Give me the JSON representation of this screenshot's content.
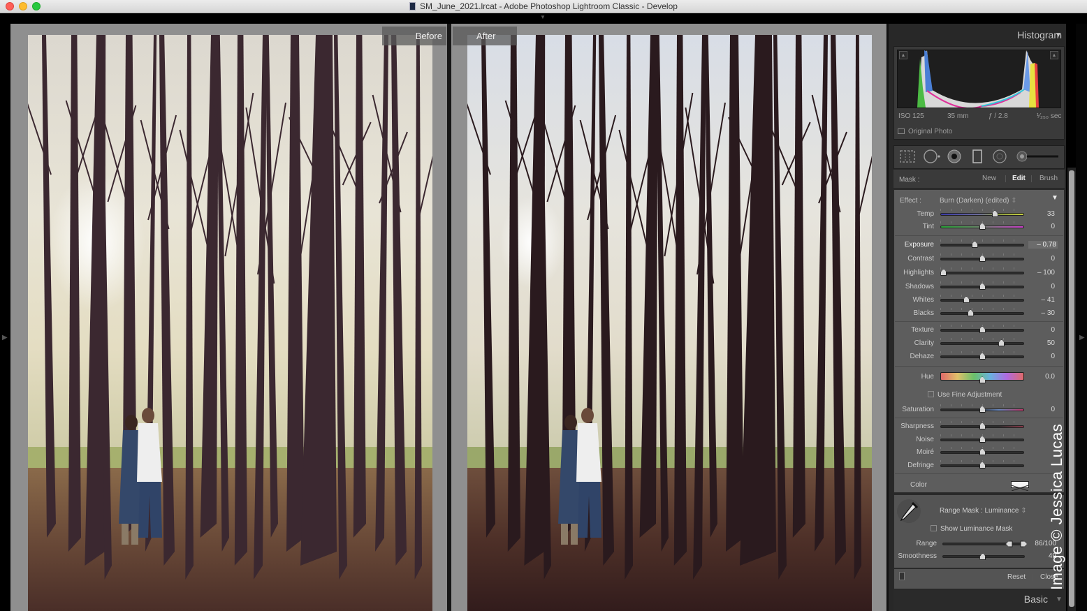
{
  "window": {
    "title": "SM_June_2021.lrcat - Adobe Photoshop Lightroom Classic - Develop"
  },
  "compare": {
    "before_label": "Before",
    "after_label": "After"
  },
  "histogram": {
    "header": "Histogram",
    "exif": {
      "iso": "ISO 125",
      "focal_length": "35 mm",
      "aperture": "ƒ / 2.8",
      "shutter": "¹⁄₂₅₀ sec"
    },
    "original_photo_label": "Original Photo",
    "original_photo_checked": false
  },
  "tool_strip": {
    "tools": [
      "crop-overlay",
      "spot-removal",
      "red-eye",
      "graduated-filter",
      "radial-filter",
      "adjustment-brush"
    ]
  },
  "mask": {
    "label": "Mask :",
    "options": [
      "New",
      "Edit",
      "Brush"
    ],
    "active": "Edit"
  },
  "effect": {
    "label": "Effect :",
    "preset": "Burn (Darken) (edited)",
    "sliders": [
      {
        "id": "temp",
        "label": "Temp",
        "value": "33",
        "pos": 0.65,
        "track": "temp"
      },
      {
        "id": "tint",
        "label": "Tint",
        "value": "0",
        "pos": 0.5,
        "track": "tint"
      },
      {
        "id": "exposure",
        "label": "Exposure",
        "value": "– 0.78",
        "pos": 0.41,
        "track": "plain",
        "highlight": true
      },
      {
        "id": "contrast",
        "label": "Contrast",
        "value": "0",
        "pos": 0.5,
        "track": "plain"
      },
      {
        "id": "highlights",
        "label": "Highlights",
        "value": "– 100",
        "pos": 0.04,
        "track": "plain"
      },
      {
        "id": "shadows",
        "label": "Shadows",
        "value": "0",
        "pos": 0.5,
        "track": "plain"
      },
      {
        "id": "whites",
        "label": "Whites",
        "value": "– 41",
        "pos": 0.31,
        "track": "plain"
      },
      {
        "id": "blacks",
        "label": "Blacks",
        "value": "– 30",
        "pos": 0.36,
        "track": "plain"
      },
      {
        "id": "texture",
        "label": "Texture",
        "value": "0",
        "pos": 0.5,
        "track": "plain"
      },
      {
        "id": "clarity",
        "label": "Clarity",
        "value": "50",
        "pos": 0.73,
        "track": "plain"
      },
      {
        "id": "dehaze",
        "label": "Dehaze",
        "value": "0",
        "pos": 0.5,
        "track": "plain"
      },
      {
        "id": "hue",
        "label": "Hue",
        "value": "0.0",
        "pos": 0.5,
        "track": "hue"
      },
      {
        "id": "saturation",
        "label": "Saturation",
        "value": "0",
        "pos": 0.5,
        "track": "sat"
      },
      {
        "id": "sharpness",
        "label": "Sharpness",
        "value": "",
        "pos": 0.5,
        "track": "sharp"
      },
      {
        "id": "noise",
        "label": "Noise",
        "value": "",
        "pos": 0.5,
        "track": "plain"
      },
      {
        "id": "moire",
        "label": "Moiré",
        "value": "",
        "pos": 0.5,
        "track": "plain"
      },
      {
        "id": "defringe",
        "label": "Defringe",
        "value": "",
        "pos": 0.5,
        "track": "plain"
      }
    ],
    "use_fine_adjustment_label": "Use Fine Adjustment",
    "use_fine_adjustment_checked": false,
    "color_label": "Color"
  },
  "range_mask": {
    "title": "Range Mask : Luminance",
    "show_mask_label": "Show Luminance Mask",
    "show_mask_checked": false,
    "range_label": "Range",
    "range_value": "86/100",
    "range_low": 0.86,
    "range_high": 1.0,
    "smoothness_label": "Smoothness",
    "smoothness_value": "49",
    "smoothness_pos": 0.49
  },
  "footer": {
    "reset_label": "Reset",
    "close_label": "Close"
  },
  "basic_header": "Basic",
  "watermark": "Image © Jessica Lucas"
}
